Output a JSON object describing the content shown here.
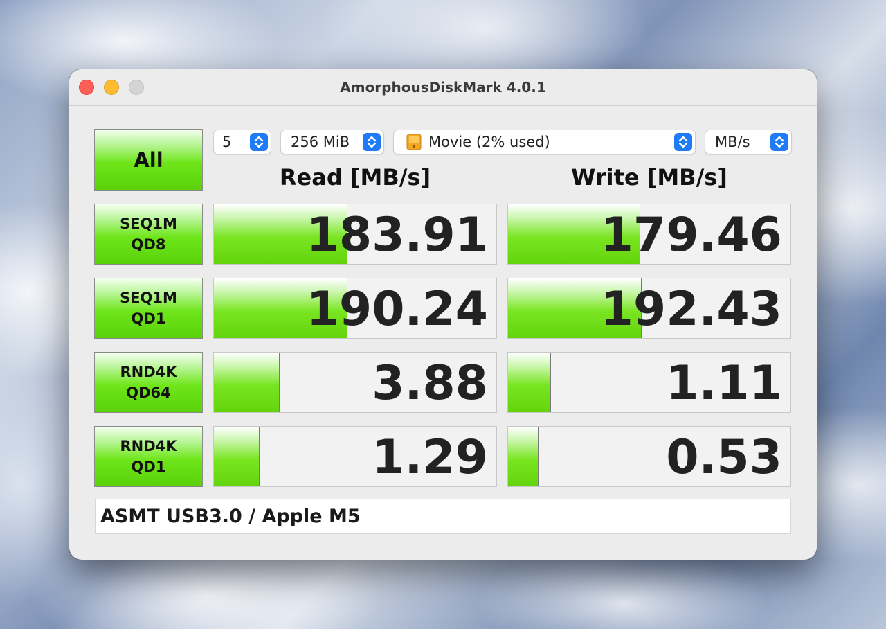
{
  "window": {
    "title": "AmorphousDiskMark 4.0.1"
  },
  "controls": {
    "all_button": "All",
    "count": {
      "value": "5"
    },
    "size": {
      "value": "256 MiB"
    },
    "drive": {
      "value": "Movie (2% used)",
      "icon": "external-drive-icon"
    },
    "unit": {
      "value": "MB/s"
    }
  },
  "headers": {
    "read": "Read [MB/s]",
    "write": "Write [MB/s]"
  },
  "tests": [
    {
      "line1": "SEQ1M",
      "line2": "QD8",
      "read": "183.91",
      "write": "179.46",
      "read_fill": 0.47,
      "write_fill": 0.465
    },
    {
      "line1": "SEQ1M",
      "line2": "QD1",
      "read": "190.24",
      "write": "192.43",
      "read_fill": 0.47,
      "write_fill": 0.47
    },
    {
      "line1": "RND4K",
      "line2": "QD64",
      "read": "3.88",
      "write": "1.11",
      "read_fill": 0.23,
      "write_fill": 0.15
    },
    {
      "line1": "RND4K",
      "line2": "QD1",
      "read": "1.29",
      "write": "0.53",
      "read_fill": 0.16,
      "write_fill": 0.105
    }
  ],
  "status": "ASMT USB3.0 / Apple M5",
  "colors": {
    "bar_green": "#63d40c",
    "select_accent": "#1f7bf6",
    "close": "#fe5f57",
    "minimize": "#febc2e"
  }
}
